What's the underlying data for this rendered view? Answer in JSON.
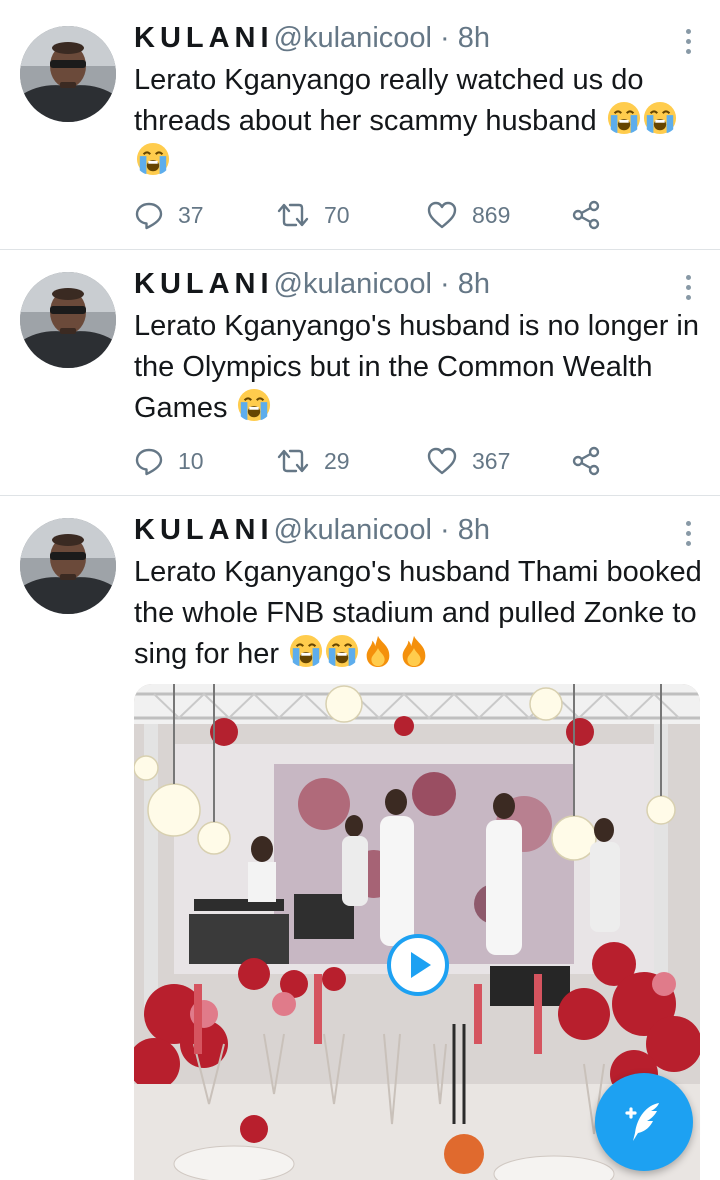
{
  "tweets": [
    {
      "name": "KULANI",
      "handle": "@kulanicool · 8h",
      "text": "Lerato Kganyango really watched us do threads about her scammy husband",
      "emojis": [
        "loudly-crying-face",
        "loudly-crying-face",
        "loudly-crying-face"
      ],
      "replies": "37",
      "retweets": "70",
      "likes": "869"
    },
    {
      "name": "KULANI",
      "handle": "@kulanicool · 8h",
      "text": "Lerato Kganyango's husband is no longer in the Olympics but in the Common Wealth Games",
      "emojis": [
        "loudly-crying-face"
      ],
      "replies": "10",
      "retweets": "29",
      "likes": "367"
    },
    {
      "name": "KULANI",
      "handle": "@kulanicool · 8h",
      "text": "Lerato Kganyango's husband Thami booked the whole FNB stadium and pulled Zonke to sing for her",
      "emojis": [
        "loudly-crying-face",
        "loudly-crying-face",
        "fire",
        "fire"
      ],
      "media": "video-thumbnail-stage-performance"
    }
  ],
  "colors": {
    "accent": "#1da1f2",
    "muted": "#657786",
    "divider": "#dfe3e6"
  },
  "icons": [
    "reply-icon",
    "retweet-icon",
    "like-icon",
    "share-icon",
    "more-icon",
    "play-icon",
    "compose-tweet-icon"
  ]
}
